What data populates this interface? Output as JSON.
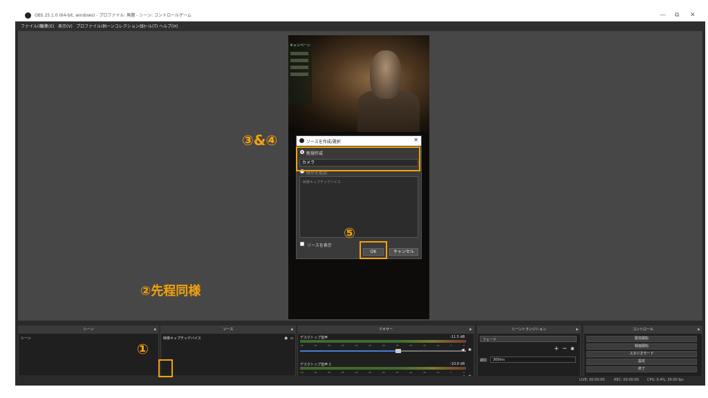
{
  "window": {
    "title": "OBS 25.1.0 (64-bit, windows) - プロファイル: 無題 - シーン: コントロールゲーム",
    "minimize": "—",
    "maximize": "⧉",
    "close": "✕"
  },
  "menu": [
    "ファイル(F)",
    "編集(E)",
    "表示(V)",
    "プロファイル(P)",
    "シーンコレクション(S)",
    "ツール(T)",
    "ヘルプ(H)"
  ],
  "game": {
    "hud_label": "キャンペーン"
  },
  "dialog": {
    "title": "ソースを作成/選択",
    "close": "✕",
    "radio_new": "新規作成",
    "name_value": "カメラ",
    "radio_existing": "既存を追加",
    "list_placeholder": "映像キャプチャデバイス",
    "checkbox_label": "ソースを表示",
    "ok": "OK",
    "cancel": "キャンセル"
  },
  "annotations": {
    "step34": "③&④",
    "step5": "⑤",
    "step2": "②先程同様",
    "step1": "①"
  },
  "docks": {
    "scenes": {
      "title": "シーン",
      "items": [
        "シーン"
      ]
    },
    "sources": {
      "title": "ソース",
      "items": [
        "映像キャプチャデバイス"
      ]
    },
    "mixer": {
      "title": "ミキサー",
      "channels": [
        {
          "name": "デスクトップ音声",
          "level": "-11.5 dB"
        },
        {
          "name": "デスクトップ音声 2",
          "level": "-10.8 dB"
        }
      ],
      "ticks": [
        "-60",
        "-55",
        "-50",
        "-45",
        "-40",
        "-35",
        "-30",
        "-25",
        "-20",
        "-15",
        "-10",
        "-5",
        "0"
      ]
    },
    "transitions": {
      "title": "シーントランジション",
      "selected": "フェード",
      "duration_label": "期間",
      "duration_value": "300ms"
    },
    "controls": {
      "title": "コントロール",
      "buttons": [
        "配信開始",
        "録画開始",
        "スタジオモード",
        "設定",
        "終了"
      ]
    }
  },
  "status": {
    "live": "LIVE: 00:00:00",
    "rec": "REC: 00:00:00",
    "cpu": "CPU: 0.4%, 30.00 fps"
  },
  "colors": {
    "accent": "#f5a20c",
    "panel": "#2a2a2a",
    "preview_bg": "#474747"
  }
}
